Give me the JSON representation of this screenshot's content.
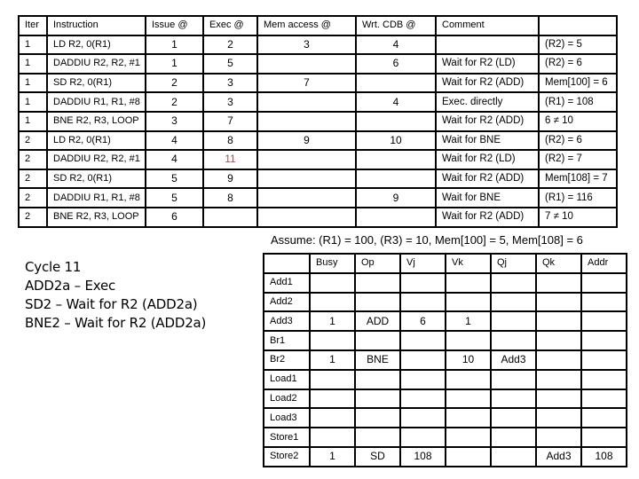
{
  "instruction_table": {
    "headers": [
      "Iter",
      "Instruction",
      "Issue @",
      "Exec @",
      "Mem access @",
      "Wrt. CDB @",
      "Comment",
      ""
    ],
    "rows": [
      {
        "iter": "1",
        "instruction": "LD R2, 0(R1)",
        "issue": "1",
        "exec": "2",
        "mem": "3",
        "cdb": "4",
        "comment": "",
        "result": "(R2) = 5"
      },
      {
        "iter": "1",
        "instruction": "DADDIU R2, R2, #1",
        "issue": "1",
        "exec": "5",
        "mem": "",
        "cdb": "6",
        "comment": "Wait for R2 (LD)",
        "result": "(R2) = 6"
      },
      {
        "iter": "1",
        "instruction": "SD R2, 0(R1)",
        "issue": "2",
        "exec": "3",
        "mem": "7",
        "cdb": "",
        "comment": "Wait for R2 (ADD)",
        "result": "Mem[100] = 6"
      },
      {
        "iter": "1",
        "instruction": "DADDIU R1, R1, #8",
        "issue": "2",
        "exec": "3",
        "mem": "",
        "cdb": "4",
        "comment": "Exec. directly",
        "result": "(R1) = 108"
      },
      {
        "iter": "1",
        "instruction": "BNE R2, R3, LOOP",
        "issue": "3",
        "exec": "7",
        "mem": "",
        "cdb": "",
        "comment": "Wait for R2 (ADD)",
        "result": "6 ≠ 10"
      },
      {
        "iter": "2",
        "instruction": "LD R2, 0(R1)",
        "issue": "4",
        "exec": "8",
        "mem": "9",
        "cdb": "10",
        "comment": "Wait for BNE",
        "result": "(R2) = 6"
      },
      {
        "iter": "2",
        "instruction": "DADDIU R2, R2, #1",
        "issue": "4",
        "exec": "11",
        "mem": "",
        "cdb": "",
        "comment": "Wait for R2 (LD)",
        "result": "(R2) = 7"
      },
      {
        "iter": "2",
        "instruction": "SD R2, 0(R1)",
        "issue": "5",
        "exec": "9",
        "mem": "",
        "cdb": "",
        "comment": "Wait for R2 (ADD)",
        "result": "Mem[108] = 7"
      },
      {
        "iter": "2",
        "instruction": "DADDIU R1, R1, #8",
        "issue": "5",
        "exec": "8",
        "mem": "",
        "cdb": "9",
        "comment": "Wait for BNE",
        "result": "(R1) = 116"
      },
      {
        "iter": "2",
        "instruction": "BNE R2, R3, LOOP",
        "issue": "6",
        "exec": "",
        "mem": "",
        "cdb": "",
        "comment": "Wait for R2 (ADD)",
        "result": "7 ≠ 10"
      }
    ],
    "highlight_color": "#8a5a5a"
  },
  "assumption": "Assume: (R1) = 100, (R3) = 10, Mem[100] = 5, Mem[108] = 6",
  "cycle_note": {
    "lines": [
      "Cycle 11",
      "ADD2a – Exec",
      "SD2 – Wait for R2 (ADD2a)",
      "BNE2 – Wait for R2 (ADD2a)"
    ]
  },
  "reservation_stations": {
    "headers": [
      "",
      "Busy",
      "Op",
      "Vj",
      "Vk",
      "Qj",
      "Qk",
      "Addr"
    ],
    "rows": [
      {
        "name": "Add1",
        "busy": "",
        "op": "",
        "vj": "",
        "vk": "",
        "qj": "",
        "qk": "",
        "addr": ""
      },
      {
        "name": "Add2",
        "busy": "",
        "op": "",
        "vj": "",
        "vk": "",
        "qj": "",
        "qk": "",
        "addr": ""
      },
      {
        "name": "Add3",
        "busy": "1",
        "op": "ADD",
        "vj": "6",
        "vk": "1",
        "qj": "",
        "qk": "",
        "addr": ""
      },
      {
        "name": "Br1",
        "busy": "",
        "op": "",
        "vj": "",
        "vk": "",
        "qj": "",
        "qk": "",
        "addr": ""
      },
      {
        "name": "Br2",
        "busy": "1",
        "op": "BNE",
        "vj": "",
        "vk": "10",
        "qj": "Add3",
        "qk": "",
        "addr": ""
      },
      {
        "name": "Load1",
        "busy": "",
        "op": "",
        "vj": "",
        "vk": "",
        "qj": "",
        "qk": "",
        "addr": ""
      },
      {
        "name": "Load2",
        "busy": "",
        "op": "",
        "vj": "",
        "vk": "",
        "qj": "",
        "qk": "",
        "addr": ""
      },
      {
        "name": "Load3",
        "busy": "",
        "op": "",
        "vj": "",
        "vk": "",
        "qj": "",
        "qk": "",
        "addr": ""
      },
      {
        "name": "Store1",
        "busy": "",
        "op": "",
        "vj": "",
        "vk": "",
        "qj": "",
        "qk": "",
        "addr": ""
      },
      {
        "name": "Store2",
        "busy": "1",
        "op": "SD",
        "vj": "108",
        "vk": "",
        "qj": "",
        "qk": "Add3",
        "addr": "108"
      }
    ]
  }
}
